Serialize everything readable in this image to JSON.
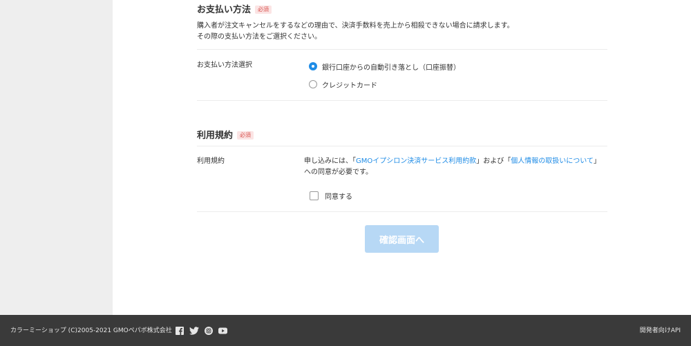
{
  "payment": {
    "title": "お支払い方法",
    "required_badge": "必須",
    "desc_line1": "購入者が注文キャンセルをするなどの理由で、決済手数料を売上から相殺できない場合に請求します。",
    "desc_line2": "その際の支払い方法をご選択ください。",
    "select_label": "お支払い方法選択",
    "options": [
      {
        "label": "銀行口座からの自動引き落とし（口座振替）",
        "selected": true
      },
      {
        "label": "クレジットカード",
        "selected": false
      }
    ]
  },
  "terms": {
    "title": "利用規約",
    "required_badge": "必須",
    "row_label": "利用規約",
    "text_part1": "申し込みには、「",
    "link1": "GMOイプシロン決済サービス利用約款",
    "text_part2": "」および「",
    "link2": "個人情報の取扱いについて",
    "text_part3": "」への同意が必要です。",
    "agree_label": "同意する",
    "agree_checked": false
  },
  "confirm_button": "確認画面へ",
  "footer": {
    "copyright": "カラーミーショップ (C)2005-2021 GMOペパボ株式会社",
    "social_icons": [
      "facebook-icon",
      "twitter-icon",
      "instagram-icon",
      "youtube-icon"
    ],
    "api_link": "開発者向けAPI"
  },
  "colors": {
    "accent": "#1f8ce6",
    "button_disabled": "#b7d8f5",
    "required_text": "#d9534f",
    "required_bg": "#fbe4e4",
    "sidebar_bg": "#eeeeee",
    "footer_bg": "#3a3a3a"
  }
}
